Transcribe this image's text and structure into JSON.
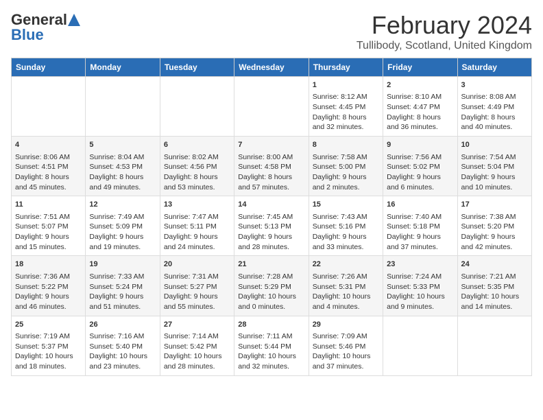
{
  "header": {
    "logo_general": "General",
    "logo_blue": "Blue",
    "title": "February 2024",
    "subtitle": "Tullibody, Scotland, United Kingdom"
  },
  "days_of_week": [
    "Sunday",
    "Monday",
    "Tuesday",
    "Wednesday",
    "Thursday",
    "Friday",
    "Saturday"
  ],
  "weeks": [
    [
      {
        "day": "",
        "content": ""
      },
      {
        "day": "",
        "content": ""
      },
      {
        "day": "",
        "content": ""
      },
      {
        "day": "",
        "content": ""
      },
      {
        "day": "1",
        "content": "Sunrise: 8:12 AM\nSunset: 4:45 PM\nDaylight: 8 hours and 32 minutes."
      },
      {
        "day": "2",
        "content": "Sunrise: 8:10 AM\nSunset: 4:47 PM\nDaylight: 8 hours and 36 minutes."
      },
      {
        "day": "3",
        "content": "Sunrise: 8:08 AM\nSunset: 4:49 PM\nDaylight: 8 hours and 40 minutes."
      }
    ],
    [
      {
        "day": "4",
        "content": "Sunrise: 8:06 AM\nSunset: 4:51 PM\nDaylight: 8 hours and 45 minutes."
      },
      {
        "day": "5",
        "content": "Sunrise: 8:04 AM\nSunset: 4:53 PM\nDaylight: 8 hours and 49 minutes."
      },
      {
        "day": "6",
        "content": "Sunrise: 8:02 AM\nSunset: 4:56 PM\nDaylight: 8 hours and 53 minutes."
      },
      {
        "day": "7",
        "content": "Sunrise: 8:00 AM\nSunset: 4:58 PM\nDaylight: 8 hours and 57 minutes."
      },
      {
        "day": "8",
        "content": "Sunrise: 7:58 AM\nSunset: 5:00 PM\nDaylight: 9 hours and 2 minutes."
      },
      {
        "day": "9",
        "content": "Sunrise: 7:56 AM\nSunset: 5:02 PM\nDaylight: 9 hours and 6 minutes."
      },
      {
        "day": "10",
        "content": "Sunrise: 7:54 AM\nSunset: 5:04 PM\nDaylight: 9 hours and 10 minutes."
      }
    ],
    [
      {
        "day": "11",
        "content": "Sunrise: 7:51 AM\nSunset: 5:07 PM\nDaylight: 9 hours and 15 minutes."
      },
      {
        "day": "12",
        "content": "Sunrise: 7:49 AM\nSunset: 5:09 PM\nDaylight: 9 hours and 19 minutes."
      },
      {
        "day": "13",
        "content": "Sunrise: 7:47 AM\nSunset: 5:11 PM\nDaylight: 9 hours and 24 minutes."
      },
      {
        "day": "14",
        "content": "Sunrise: 7:45 AM\nSunset: 5:13 PM\nDaylight: 9 hours and 28 minutes."
      },
      {
        "day": "15",
        "content": "Sunrise: 7:43 AM\nSunset: 5:16 PM\nDaylight: 9 hours and 33 minutes."
      },
      {
        "day": "16",
        "content": "Sunrise: 7:40 AM\nSunset: 5:18 PM\nDaylight: 9 hours and 37 minutes."
      },
      {
        "day": "17",
        "content": "Sunrise: 7:38 AM\nSunset: 5:20 PM\nDaylight: 9 hours and 42 minutes."
      }
    ],
    [
      {
        "day": "18",
        "content": "Sunrise: 7:36 AM\nSunset: 5:22 PM\nDaylight: 9 hours and 46 minutes."
      },
      {
        "day": "19",
        "content": "Sunrise: 7:33 AM\nSunset: 5:24 PM\nDaylight: 9 hours and 51 minutes."
      },
      {
        "day": "20",
        "content": "Sunrise: 7:31 AM\nSunset: 5:27 PM\nDaylight: 9 hours and 55 minutes."
      },
      {
        "day": "21",
        "content": "Sunrise: 7:28 AM\nSunset: 5:29 PM\nDaylight: 10 hours and 0 minutes."
      },
      {
        "day": "22",
        "content": "Sunrise: 7:26 AM\nSunset: 5:31 PM\nDaylight: 10 hours and 4 minutes."
      },
      {
        "day": "23",
        "content": "Sunrise: 7:24 AM\nSunset: 5:33 PM\nDaylight: 10 hours and 9 minutes."
      },
      {
        "day": "24",
        "content": "Sunrise: 7:21 AM\nSunset: 5:35 PM\nDaylight: 10 hours and 14 minutes."
      }
    ],
    [
      {
        "day": "25",
        "content": "Sunrise: 7:19 AM\nSunset: 5:37 PM\nDaylight: 10 hours and 18 minutes."
      },
      {
        "day": "26",
        "content": "Sunrise: 7:16 AM\nSunset: 5:40 PM\nDaylight: 10 hours and 23 minutes."
      },
      {
        "day": "27",
        "content": "Sunrise: 7:14 AM\nSunset: 5:42 PM\nDaylight: 10 hours and 28 minutes."
      },
      {
        "day": "28",
        "content": "Sunrise: 7:11 AM\nSunset: 5:44 PM\nDaylight: 10 hours and 32 minutes."
      },
      {
        "day": "29",
        "content": "Sunrise: 7:09 AM\nSunset: 5:46 PM\nDaylight: 10 hours and 37 minutes."
      },
      {
        "day": "",
        "content": ""
      },
      {
        "day": "",
        "content": ""
      }
    ]
  ]
}
